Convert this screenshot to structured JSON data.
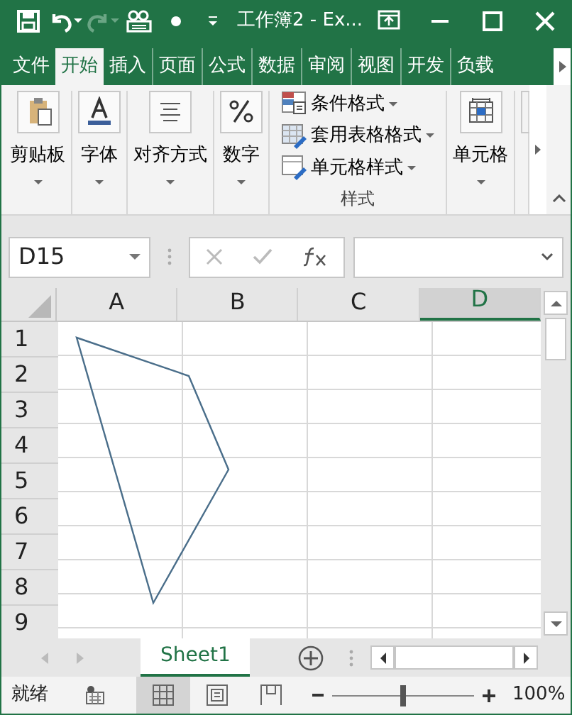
{
  "title_bar": {
    "quick_access": [
      {
        "kind": "save",
        "disabled": false
      },
      {
        "kind": "undo",
        "disabled": false
      },
      {
        "kind": "redo",
        "disabled": true
      },
      {
        "kind": "form",
        "disabled": false
      },
      {
        "kind": "dot",
        "disabled": false
      },
      {
        "kind": "customize",
        "disabled": false
      }
    ],
    "title": "工作簿2 - Ex..."
  },
  "ribbon_tabs": [
    {
      "label": "文件",
      "selected": false
    },
    {
      "label": "开始",
      "selected": true
    },
    {
      "label": "插入",
      "selected": false
    },
    {
      "label": "页面",
      "selected": false
    },
    {
      "label": "公式",
      "selected": false
    },
    {
      "label": "数据",
      "selected": false
    },
    {
      "label": "审阅",
      "selected": false
    },
    {
      "label": "视图",
      "selected": false
    },
    {
      "label": "开发",
      "selected": false
    },
    {
      "label": "负载",
      "selected": false
    }
  ],
  "ribbon_groups": [
    {
      "kind": "big",
      "label": "剪贴板"
    },
    {
      "kind": "big",
      "label": "字体"
    },
    {
      "kind": "big",
      "label": "对齐方式"
    },
    {
      "kind": "big",
      "label": "数字"
    },
    {
      "kind": "list",
      "label": "样式",
      "items": [
        "条件格式",
        "套用表格格式",
        "单元格样式"
      ]
    },
    {
      "kind": "big",
      "label": "单元格"
    }
  ],
  "formula_bar": {
    "name_box": "D15"
  },
  "sheet": {
    "columns": [
      {
        "label": "A",
        "selected": false
      },
      {
        "label": "B",
        "selected": false
      },
      {
        "label": "C",
        "selected": false
      },
      {
        "label": "D",
        "selected": true
      }
    ],
    "rows": [
      "1",
      "2",
      "3",
      "4",
      "5",
      "6",
      "7",
      "8",
      "9"
    ]
  },
  "sheet_tabs": [
    {
      "label": "Sheet1",
      "selected": true
    }
  ],
  "status_bar": {
    "status": "就绪",
    "views": [
      {
        "kind": "normal",
        "selected": true
      },
      {
        "kind": "page-layout",
        "selected": false
      },
      {
        "kind": "page-break",
        "selected": false
      }
    ],
    "zoom": {
      "level": 0.5,
      "reading": "100%"
    }
  }
}
